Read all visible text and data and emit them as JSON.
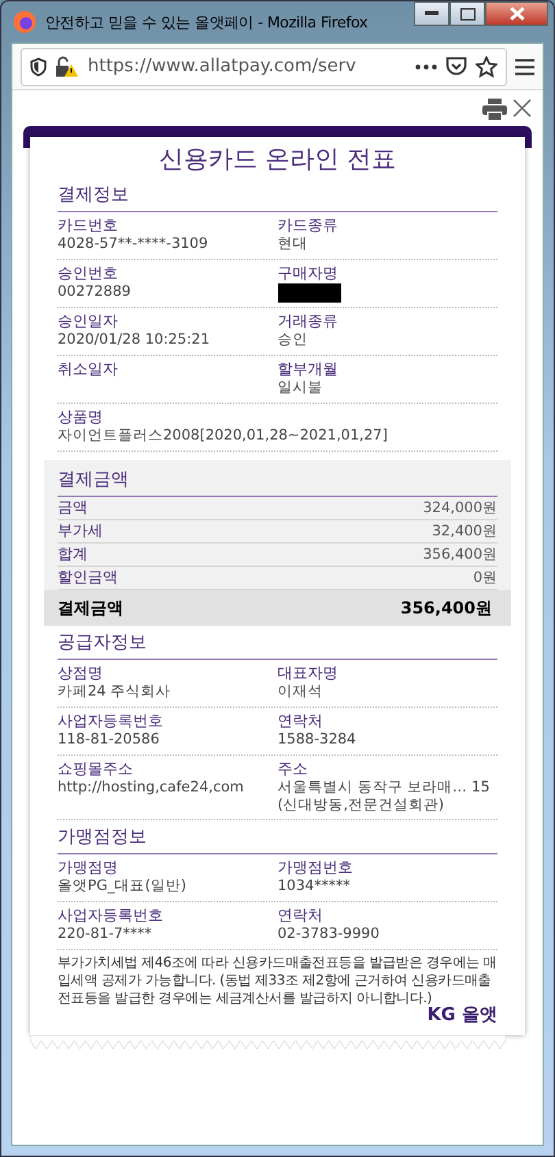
{
  "window": {
    "title": "안전하고 믿을 수 있는 올앳페이 - Mozilla Firefox"
  },
  "address_bar": {
    "url": "https://www.allatpay.com/serv"
  },
  "receipt": {
    "title": "신용카드 온라인 전표",
    "sections": [
      {
        "kind": "fields",
        "heading": "결제정보",
        "rows": [
          [
            {
              "label": "카드번호",
              "value": "4028-57**-****-3109"
            },
            {
              "label": "카드종류",
              "value": "현대"
            }
          ],
          [
            {
              "label": "승인번호",
              "value": "00272889"
            },
            {
              "label": "구매자명",
              "redacted": true
            }
          ],
          [
            {
              "label": "승인일자",
              "value": "2020/01/28 10:25:21"
            },
            {
              "label": "거래종류",
              "value": "승인"
            }
          ],
          [
            {
              "label": "취소일자"
            },
            {
              "label": "할부개월",
              "value": "일시불"
            }
          ],
          [
            {
              "label": "상품명",
              "value": "자이언트플러스2008[2020,01,28~2021,01,27]"
            }
          ]
        ]
      },
      {
        "kind": "amounts",
        "heading": "결제금액",
        "items": [
          {
            "label": "금액",
            "value": "324,000원"
          },
          {
            "label": "부가세",
            "value": "32,400원"
          },
          {
            "label": "합계",
            "value": "356,400원"
          },
          {
            "label": "할인금액",
            "value": "0원"
          }
        ],
        "total": {
          "label": "결제금액",
          "value": "356,400원"
        }
      },
      {
        "kind": "fields",
        "heading": "공급자정보",
        "rows": [
          [
            {
              "label": "상점명",
              "value": "카페24 주식회사"
            },
            {
              "label": "대표자명",
              "value": "이재석"
            }
          ],
          [
            {
              "label": "사업자등록번호",
              "value": "118-81-20586"
            },
            {
              "label": "연락처",
              "value": "1588-3284"
            }
          ],
          [
            {
              "label": "쇼핑몰주소",
              "value": "http://hosting,cafe24,com"
            },
            {
              "label": "주소",
              "value": "서울특별시 동작구 보라매… 15 (신대방동,전문건설회관)"
            }
          ]
        ]
      },
      {
        "kind": "fields",
        "heading": "가맹점정보",
        "rows": [
          [
            {
              "label": "가맹점명",
              "value": "올앳PG_대표(일반)"
            },
            {
              "label": "가맹점번호",
              "value": "1034*****"
            }
          ],
          [
            {
              "label": "사업자등록번호",
              "value": "220-81-7****"
            },
            {
              "label": "연락처",
              "value": "02-3783-9990"
            }
          ]
        ]
      }
    ],
    "notice": "부가가치세법 제46조에 따라 신용카드매출전표등을 발급받은 경우에는 매입세액 공제가 가능합니다. (동법 제33조 제2항에 근거하여 신용카드매출전표등을 발급한 경우에는 세금계산서를 발급하지 아니합니다.)",
    "logo": "KG 올앳"
  }
}
